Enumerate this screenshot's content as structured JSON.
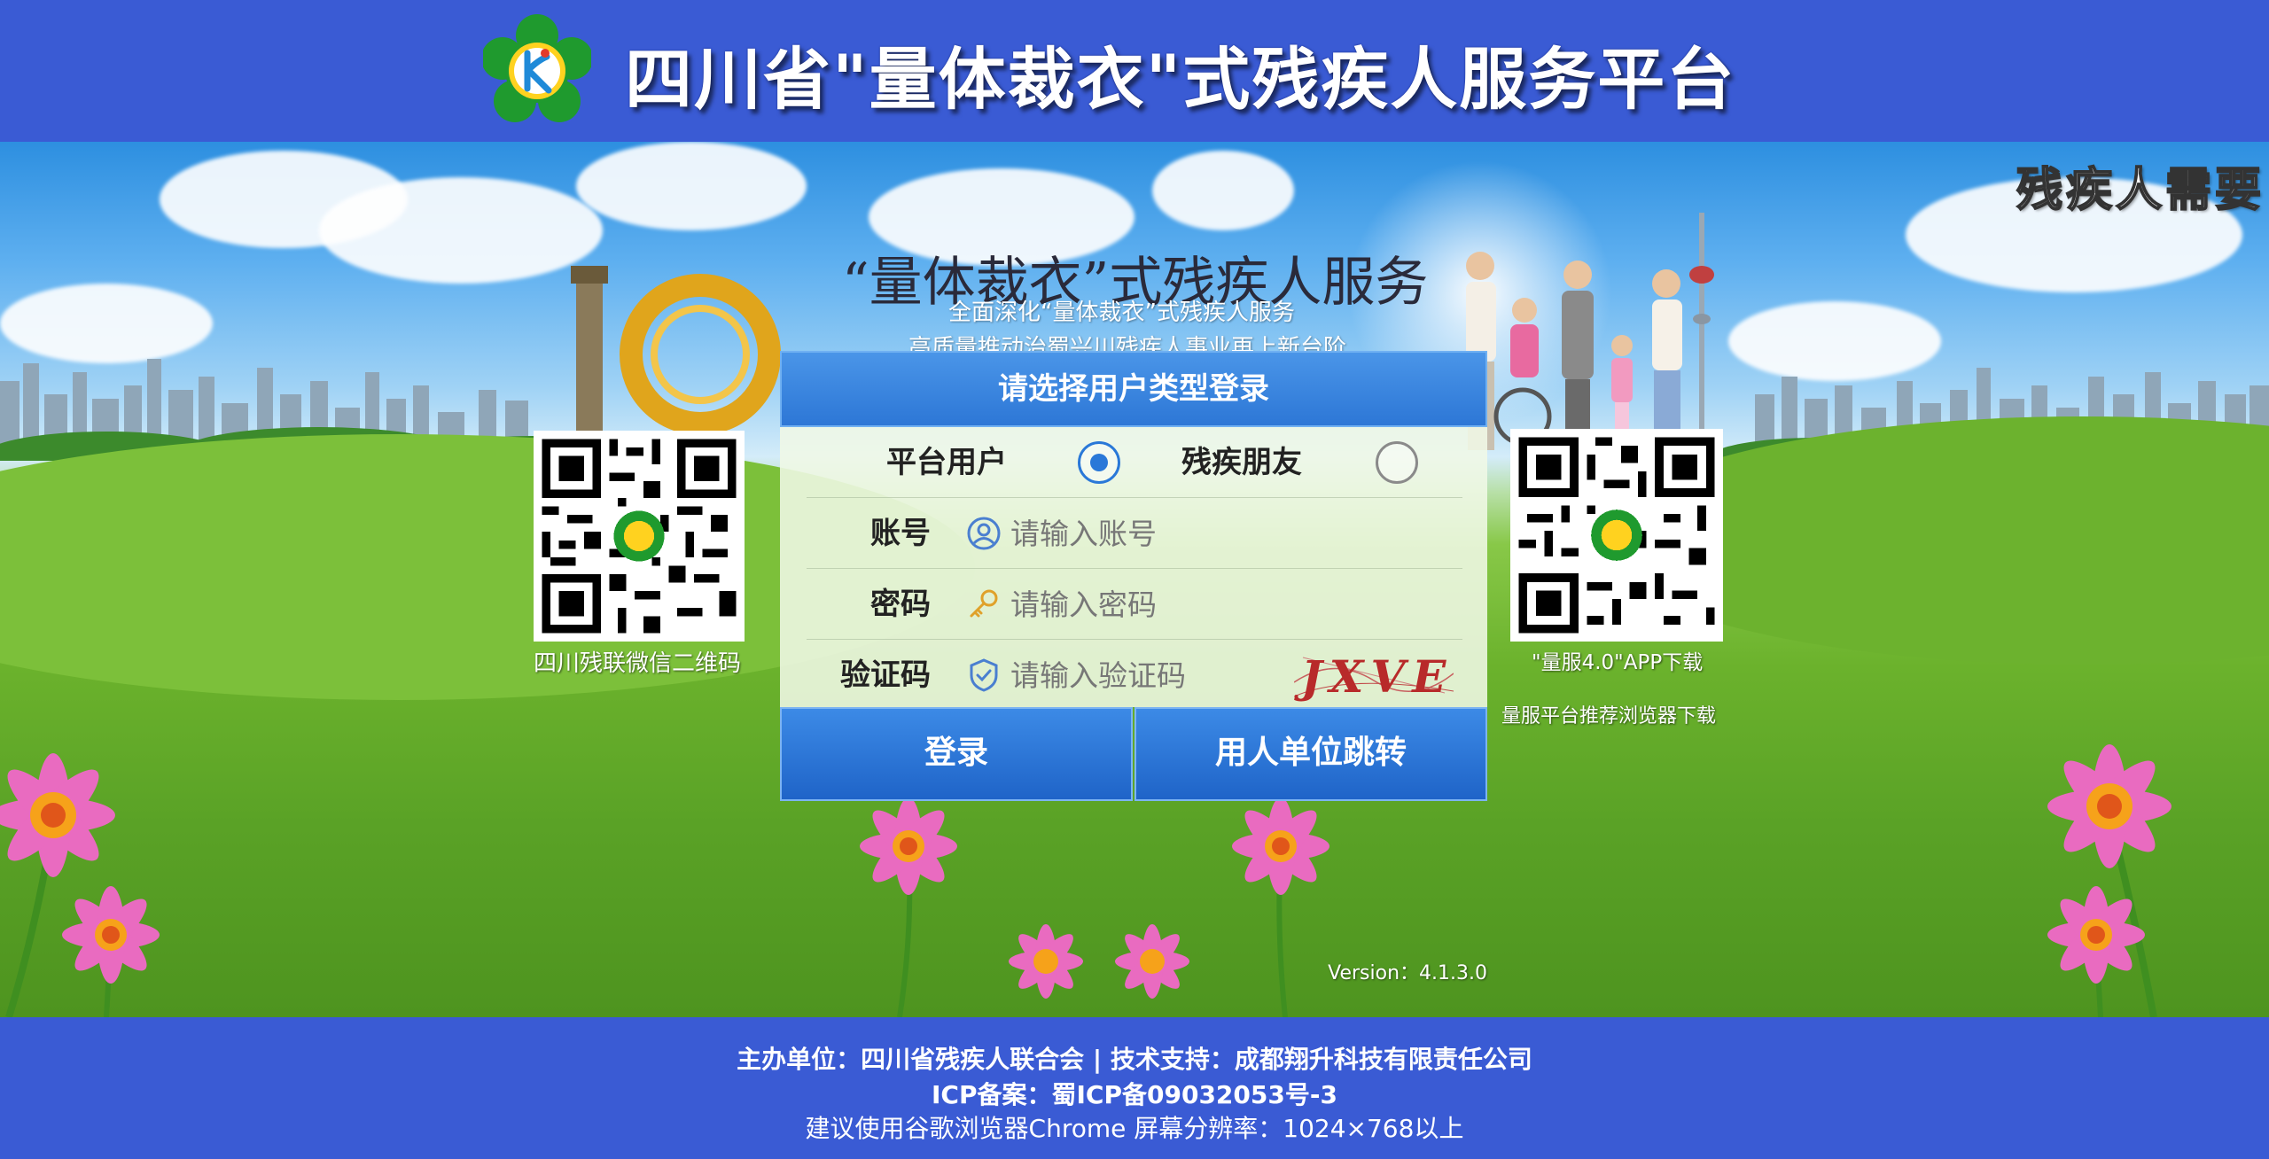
{
  "header": {
    "title": "四川省\"量体裁衣\"式残疾人服务平台",
    "logo_icon": "disability-federation-logo-icon"
  },
  "banner": {
    "scroll_text": "残疾人需要",
    "title": "“量体裁衣”式残疾人服务",
    "subtitle_1": "全面深化“量体裁衣”式残疾人服务",
    "subtitle_2": "高质量推动治蜀兴川残疾人事业再上新台阶"
  },
  "qr_left": {
    "caption": "四川残联微信二维码"
  },
  "qr_right": {
    "caption": "\"量服4.0\"APP下载",
    "link": "量服平台推荐浏览器下载"
  },
  "login": {
    "heading": "请选择用户类型登录",
    "user_types": [
      {
        "label": "平台用户",
        "selected": true
      },
      {
        "label": "残疾朋友",
        "selected": false
      }
    ],
    "account": {
      "label": "账号",
      "placeholder": "请输入账号",
      "value": ""
    },
    "password": {
      "label": "密码",
      "placeholder": "请输入密码",
      "value": ""
    },
    "captcha": {
      "label": "验证码",
      "placeholder": "请输入验证码",
      "value": "",
      "image_text": "JXVE"
    },
    "login_button": "登录",
    "employer_button": "用人单位跳转",
    "version": "Version：4.1.3.0"
  },
  "footer": {
    "line1": "主办单位：四川省残疾人联合会 | 技术支持：成都翔升科技有限责任公司",
    "line2": "ICP备案：蜀ICP备09032053号-3",
    "line3": "建议使用谷歌浏览器Chrome  屏幕分辨率：1024×768以上"
  },
  "colors": {
    "header_bg": "#3a5bd4",
    "button_blue": "#2a72d6",
    "panel_bg": "#f0f8e6"
  }
}
